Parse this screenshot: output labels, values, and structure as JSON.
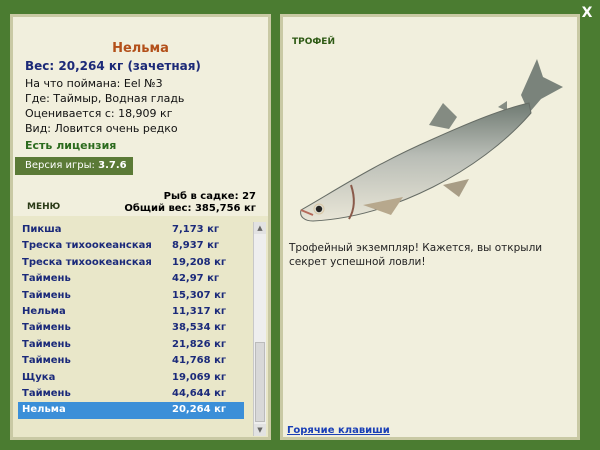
{
  "close": {
    "label": "X"
  },
  "fish": {
    "name": "Нельма",
    "weight_line": "Вес: 20,264 кг (зачетная)",
    "bait_line": "На что поймана: Eel №3",
    "location_line": "Где: Таймыр, Водная гладь",
    "value_line": "Оценивается с: 18,909 кг",
    "kind_line": "Вид: Ловится очень редко"
  },
  "license": "Есть лицензия",
  "version": {
    "label": "Версия игры: ",
    "value": "3.7.6"
  },
  "menu_label": "МЕНЮ",
  "stats": {
    "count_line": "Рыб в садке: 27",
    "total_line": "Общий вес: 385,756 кг"
  },
  "catch_list": [
    {
      "name": "Пикша",
      "weight": "7,173 кг"
    },
    {
      "name": "Треска тихоокеанская",
      "weight": "8,937 кг"
    },
    {
      "name": "Треска тихоокеанская",
      "weight": "19,208 кг"
    },
    {
      "name": "Таймень",
      "weight": "42,97 кг"
    },
    {
      "name": "Таймень",
      "weight": "15,307 кг"
    },
    {
      "name": "Нельма",
      "weight": "11,317 кг"
    },
    {
      "name": "Таймень",
      "weight": "38,534 кг"
    },
    {
      "name": "Таймень",
      "weight": "21,826 кг"
    },
    {
      "name": "Таймень",
      "weight": "41,768 кг"
    },
    {
      "name": "Щука",
      "weight": "19,069 кг"
    },
    {
      "name": "Таймень",
      "weight": "44,644 кг"
    },
    {
      "name": "Нельма",
      "weight": "20,264 кг"
    }
  ],
  "selected_index": 11,
  "trophy": {
    "label": "ТРОФЕЙ",
    "text": "Трофейный экземпляр! Кажется, вы открыли секрет успешной ловли!",
    "image_icon": "fish-illustration"
  },
  "hotkeys_link": "Горячие клавиши",
  "colors": {
    "frame": "#4b7c31",
    "panel": "#f1efdd",
    "fish_name": "#b3501a",
    "list_text": "#1b2a7a",
    "selected_row": "#3b8fd8",
    "link": "#1a3fb6"
  }
}
